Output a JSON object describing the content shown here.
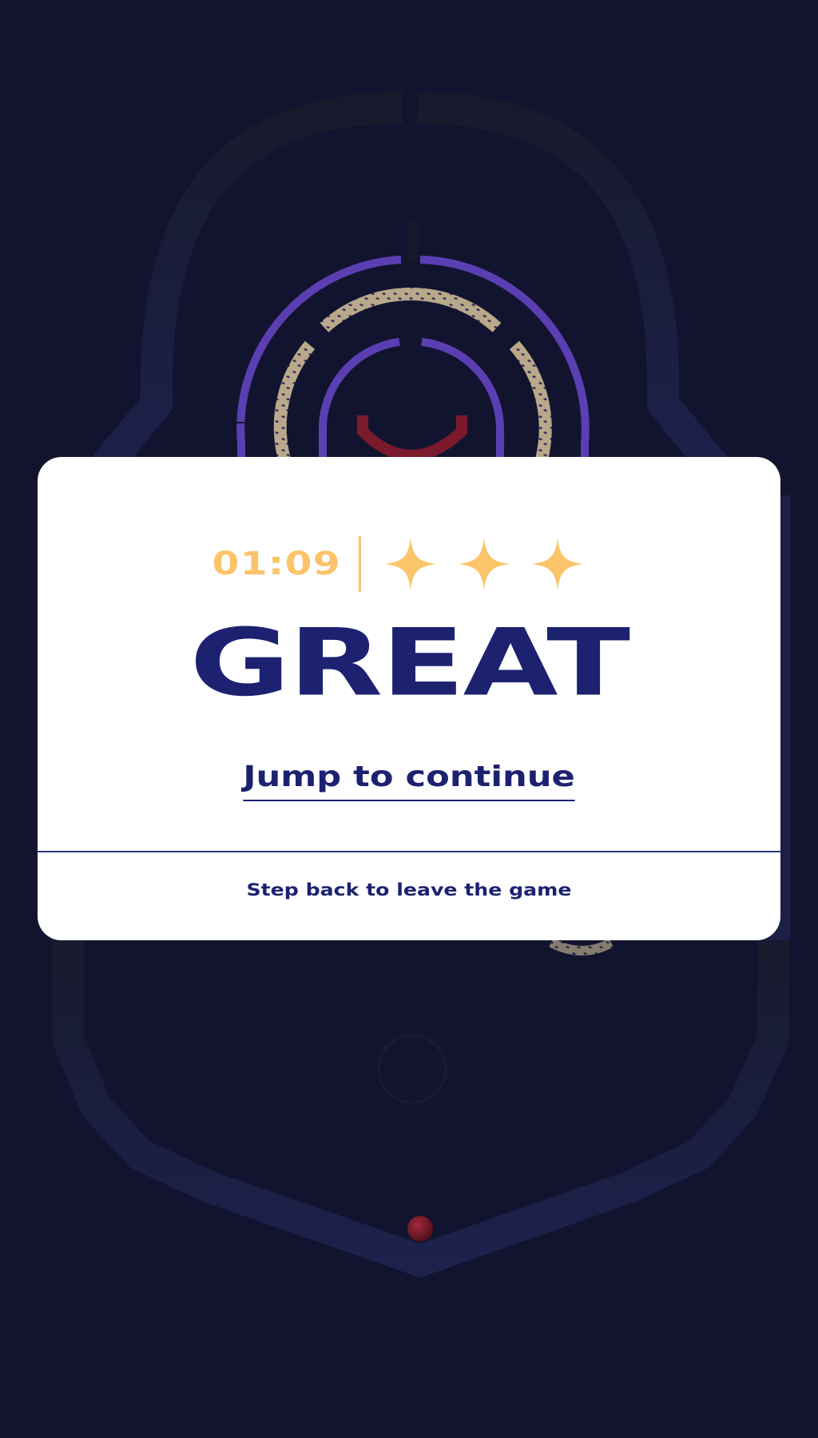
{
  "result": {
    "time": "01:09",
    "stars_earned": 3,
    "stars_total": 3,
    "headline": "GREAT",
    "continue_prompt": "Jump to continue",
    "leave_prompt": "Step back to leave the game"
  },
  "colors": {
    "background": "#12142f",
    "card": "#ffffff",
    "accent_gold": "#fbc46a",
    "navy_text": "#1c2270",
    "maze_ring_purple": "#5b3fb2",
    "ball_red": "#7a1524"
  },
  "icons": {
    "star": "four-point-star-icon",
    "ball": "ball-icon"
  }
}
